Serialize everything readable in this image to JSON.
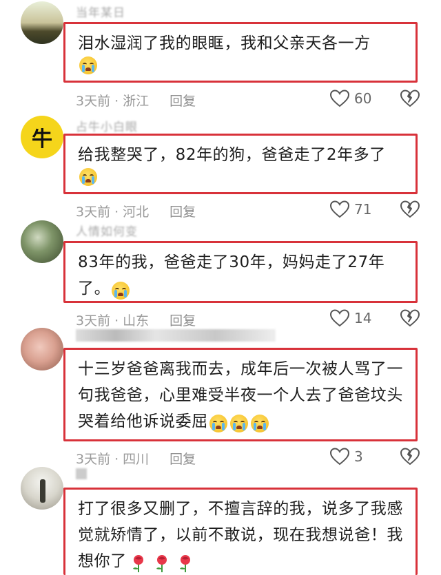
{
  "comments": [
    {
      "username": "当年某日",
      "text": "泪水湿润了我的眼眶，我和父亲天各一方",
      "emoji_count": 1,
      "time": "3天前",
      "location": "浙江",
      "reply_label": "回复",
      "likes": "60"
    },
    {
      "username": "占牛小白眼",
      "text": "给我整哭了，82年的狗，爸爸走了2年多了",
      "emoji_count": 1,
      "time": "3天前",
      "location": "河北",
      "reply_label": "回复",
      "likes": "71"
    },
    {
      "username": "人情如何变",
      "text": "83年的我，爸爸走了30年，妈妈走了27年了。",
      "emoji_count": 1,
      "time": "3天前",
      "location": "山东",
      "reply_label": "回复",
      "likes": "14"
    },
    {
      "username": "",
      "text": "十三岁爸爸离我而去，成年后一次被人骂了一句我爸爸，心里难受半夜一个人去了爸爸坟头哭着给他诉说委屈",
      "emoji_count": 3,
      "time": "3天前",
      "location": "四川",
      "reply_label": "回复",
      "likes": "3"
    },
    {
      "username": "",
      "text": "打了很多又删了，不擅言辞的我，说多了我感觉就矫情了，以前不敢说，现在我想说爸！我想你了",
      "emoji_count": 0,
      "rose_count": 3
    }
  ],
  "icons": {
    "like": "heart-outline-icon",
    "dislike": "broken-heart-icon",
    "emoji": "loudly-crying-face-emoji",
    "rose": "rose-emoji"
  },
  "colors": {
    "highlight_border": "#d8323a",
    "meta_text": "#9a9a9a",
    "body_text": "#1e1e1e"
  }
}
